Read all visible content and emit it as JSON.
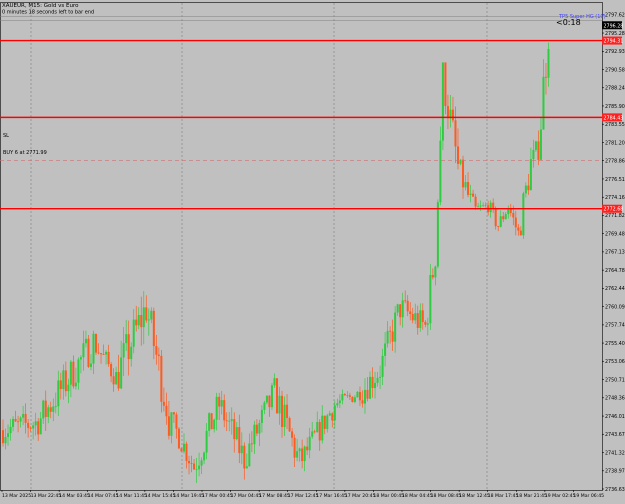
{
  "header": {
    "symbol_line": "XAUEUR, M15: Gold vs Euro",
    "timer_line": "0 minutes 18 seconds left to bar end",
    "countdown": "<0:18"
  },
  "indicators": {
    "sl_label": "SL",
    "buy_label": "BUY 6 at 2771.99",
    "tp_label": "TP5 Super HG (10)"
  },
  "colors": {
    "background": "#c0c0c0",
    "bull": "#2ecc40",
    "bear": "#ff5a1f",
    "level_line": "#ff0000",
    "level_tag": "#ff2020",
    "current_tag": "#000000",
    "grid": "#7f7f7f",
    "tp_text": "#4040ff"
  },
  "chart_data": {
    "type": "candlestick",
    "symbol": "XAUEUR",
    "timeframe": "M15",
    "y_range": [
      2736.5,
      2798.5
    ],
    "y_ticks": [
      "2797.62",
      "2795.28",
      "2792.93",
      "2790.58",
      "2788.24",
      "2785.90",
      "2783.55",
      "2781.20",
      "2778.86",
      "2776.51",
      "2774.16",
      "2771.82",
      "2769.48",
      "2767.13",
      "2764.78",
      "2762.44",
      "2760.09",
      "2757.74",
      "2755.40",
      "2753.06",
      "2750.71",
      "2748.36",
      "2746.01",
      "2743.67",
      "2741.32",
      "2738.97",
      "2736.63"
    ],
    "x_labels": [
      "13 Mar 2025",
      "13 Mar 22:45",
      "14 Mar 03:45",
      "14 Mar 07:45",
      "14 Mar 11:45",
      "14 Mar 15:45",
      "14 Mar 19:45",
      "17 Mar 00:45",
      "17 Mar 04:45",
      "17 Mar 08:45",
      "17 Mar 12:45",
      "17 Mar 16:45",
      "17 Mar 20:45",
      "18 Mar 00:45",
      "18 Mar 04:45",
      "18 Mar 08:45",
      "18 Mar 12:45",
      "18 Mar 17:45",
      "18 Mar 21:45",
      "19 Mar 02:45",
      "19 Mar 06:45"
    ],
    "levels": [
      {
        "value": 2794.31,
        "label": "2794.31"
      },
      {
        "value": 2784.43,
        "label": "2784.43"
      },
      {
        "value": 2772.68,
        "label": "2772.68"
      },
      {
        "value": 2778.86,
        "label": "2778.86"
      }
    ],
    "current_price": "2796.28",
    "segments": [
      {
        "count": 15,
        "start": 2744.2,
        "end": 2745.2,
        "lo": 2741.5,
        "hi": 2751.5
      },
      {
        "count": 22,
        "start": 2745.2,
        "end": 2755.5,
        "lo": 2744.0,
        "hi": 2757.0
      },
      {
        "count": 9,
        "start": 2755.5,
        "end": 2751.0,
        "lo": 2747.5,
        "hi": 2756.5
      },
      {
        "count": 12,
        "start": 2751.0,
        "end": 2760.0,
        "lo": 2748.0,
        "hi": 2764.0
      },
      {
        "count": 9,
        "start": 2760.0,
        "end": 2746.0,
        "lo": 2743.0,
        "hi": 2760.0
      },
      {
        "count": 10,
        "start": 2746.0,
        "end": 2739.5,
        "lo": 2737.0,
        "hi": 2746.5
      },
      {
        "count": 10,
        "start": 2739.5,
        "end": 2747.5,
        "lo": 2737.0,
        "hi": 2749.0
      },
      {
        "count": 10,
        "start": 2747.5,
        "end": 2740.5,
        "lo": 2737.5,
        "hi": 2749.5
      },
      {
        "count": 12,
        "start": 2740.5,
        "end": 2749.0,
        "lo": 2739.5,
        "hi": 2751.5
      },
      {
        "count": 10,
        "start": 2749.0,
        "end": 2740.0,
        "lo": 2737.0,
        "hi": 2750.0
      },
      {
        "count": 14,
        "start": 2740.0,
        "end": 2747.5,
        "lo": 2738.5,
        "hi": 2748.0
      },
      {
        "count": 10,
        "start": 2747.5,
        "end": 2749.0,
        "lo": 2744.5,
        "hi": 2750.0
      },
      {
        "count": 8,
        "start": 2749.0,
        "end": 2752.0,
        "lo": 2746.0,
        "hi": 2757.0
      },
      {
        "count": 8,
        "start": 2752.0,
        "end": 2760.0,
        "lo": 2750.0,
        "hi": 2762.0
      },
      {
        "count": 10,
        "start": 2760.0,
        "end": 2757.5,
        "lo": 2753.0,
        "hi": 2763.5
      },
      {
        "count": 4,
        "start": 2757.5,
        "end": 2767.0,
        "lo": 2756.0,
        "hi": 2770.5
      },
      {
        "count": 3,
        "start": 2767.0,
        "end": 2790.0,
        "lo": 2765.0,
        "hi": 2791.5
      },
      {
        "count": 6,
        "start": 2790.0,
        "end": 2778.0,
        "lo": 2775.0,
        "hi": 2791.0
      },
      {
        "count": 6,
        "start": 2778.0,
        "end": 2772.5,
        "lo": 2768.5,
        "hi": 2779.5
      },
      {
        "count": 6,
        "start": 2772.5,
        "end": 2773.0,
        "lo": 2770.5,
        "hi": 2775.0
      },
      {
        "count": 4,
        "start": 2773.0,
        "end": 2770.5,
        "lo": 2768.0,
        "hi": 2774.5
      },
      {
        "count": 4,
        "start": 2770.5,
        "end": 2773.0,
        "lo": 2769.5,
        "hi": 2775.5
      },
      {
        "count": 4,
        "start": 2773.0,
        "end": 2769.5,
        "lo": 2767.0,
        "hi": 2774.0
      },
      {
        "count": 5,
        "start": 2769.5,
        "end": 2778.5,
        "lo": 2768.5,
        "hi": 2781.5
      },
      {
        "count": 3,
        "start": 2778.5,
        "end": 2780.5,
        "lo": 2776.5,
        "hi": 2786.0
      },
      {
        "count": 4,
        "start": 2780.5,
        "end": 2796.0,
        "lo": 2779.0,
        "hi": 2798.2
      }
    ],
    "title": "XAUEUR, M15: Gold vs Euro",
    "xlabel": "",
    "ylabel": "",
    "grid": true
  }
}
